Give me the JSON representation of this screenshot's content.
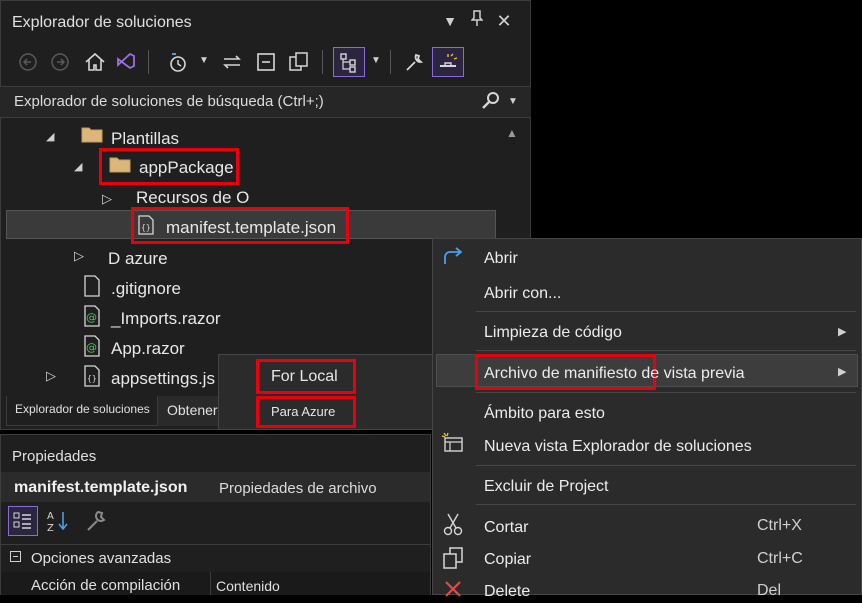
{
  "solution_explorer": {
    "title": "Explorador de soluciones",
    "search_placeholder": "Explorador de soluciones de búsqueda (Ctrl+;)",
    "tree": {
      "plantillas": "Plantillas",
      "appPackage": "appPackage",
      "recursos": "Recursos de O",
      "manifest": "manifest.template.json",
      "azure": "D azure",
      "gitignore": ".gitignore",
      "imports": "_Imports.razor",
      "app": "App.razor",
      "appsettings": "appsettings.js"
    },
    "tabs": [
      "Explorador de soluciones",
      "Obtener Chi"
    ]
  },
  "properties": {
    "title": "Propiedades",
    "object_name": "manifest.template.json",
    "object_type": "Propiedades de archivo",
    "section": "Opciones avanzadas",
    "row_label": "Acción de compilación",
    "row_value": "Contenido"
  },
  "submenu": {
    "items": [
      "For Local",
      "Para Azure"
    ]
  },
  "context_menu": {
    "items": [
      {
        "label": "Abrir",
        "icon": "open-arrow-icon"
      },
      {
        "label": "Abrir con..."
      },
      {
        "label": "Limpieza de código",
        "submenu": true
      },
      {
        "label": "Archivo de manifiesto de vista previa",
        "submenu": true
      },
      {
        "label": "Ámbito para esto"
      },
      {
        "label": "Nueva vista Explorador de soluciones",
        "icon": "new-view-icon"
      },
      {
        "label": "Excluir de Project"
      },
      {
        "label": "Cortar",
        "shortcut": "Ctrl+X",
        "icon": "scissors-icon"
      },
      {
        "label": "Copiar",
        "shortcut": "Ctrl+C",
        "icon": "copy-icon"
      },
      {
        "label": "Delete",
        "shortcut": "Del",
        "icon": "delete-x-icon"
      }
    ]
  },
  "colors": {
    "accent": "#8a6bd6",
    "highlight": "#e8000d",
    "panel": "#1f1f1f",
    "menu": "#2b2b2b"
  }
}
